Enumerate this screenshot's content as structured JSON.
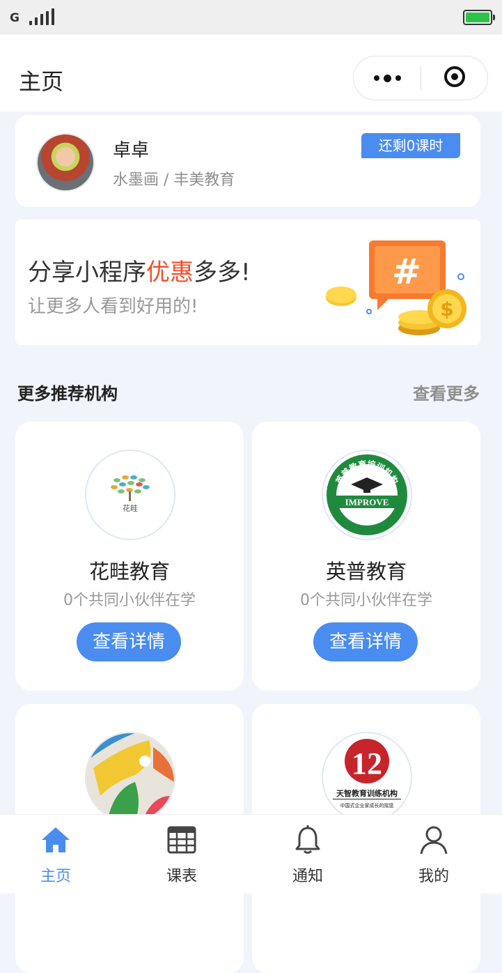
{
  "status_bar": {
    "network": "G"
  },
  "navbar": {
    "title": "主页"
  },
  "profile": {
    "name": "卓卓",
    "subtitle": "水墨画 / 丰美教育",
    "badge": "还剩0课时"
  },
  "banner": {
    "title_prefix": "分享小程序",
    "title_highlight": "优惠",
    "title_suffix": "多多!",
    "subtitle": "让更多人看到好用的!"
  },
  "section": {
    "title": "更多推荐机构",
    "more": "查看更多"
  },
  "orgs": [
    {
      "name": "花畦教育",
      "count": "0个共同小伙伴在学",
      "button": "查看详情",
      "logo_text": "花畦"
    },
    {
      "name": "英普教育",
      "count": "0个共同小伙伴在学",
      "button": "查看详情",
      "logo_text": "英普教育培训机构",
      "logo_band": "IMPROVE"
    },
    {
      "name": "",
      "count": "",
      "button": ""
    },
    {
      "name": "",
      "count": "",
      "button": "",
      "logo_text": "天智教育训练机构",
      "logo_sub": "中国式企业家成长的摇篮"
    }
  ],
  "tabbar": {
    "items": [
      {
        "label": "主页",
        "icon": "home-icon",
        "active": true
      },
      {
        "label": "课表",
        "icon": "calendar-grid-icon",
        "active": false
      },
      {
        "label": "通知",
        "icon": "bell-icon",
        "active": false
      },
      {
        "label": "我的",
        "icon": "user-icon",
        "active": false
      }
    ]
  },
  "colors": {
    "accent": "#4a8cf0",
    "highlight": "#f04f2a",
    "background": "#f1f4fb"
  }
}
